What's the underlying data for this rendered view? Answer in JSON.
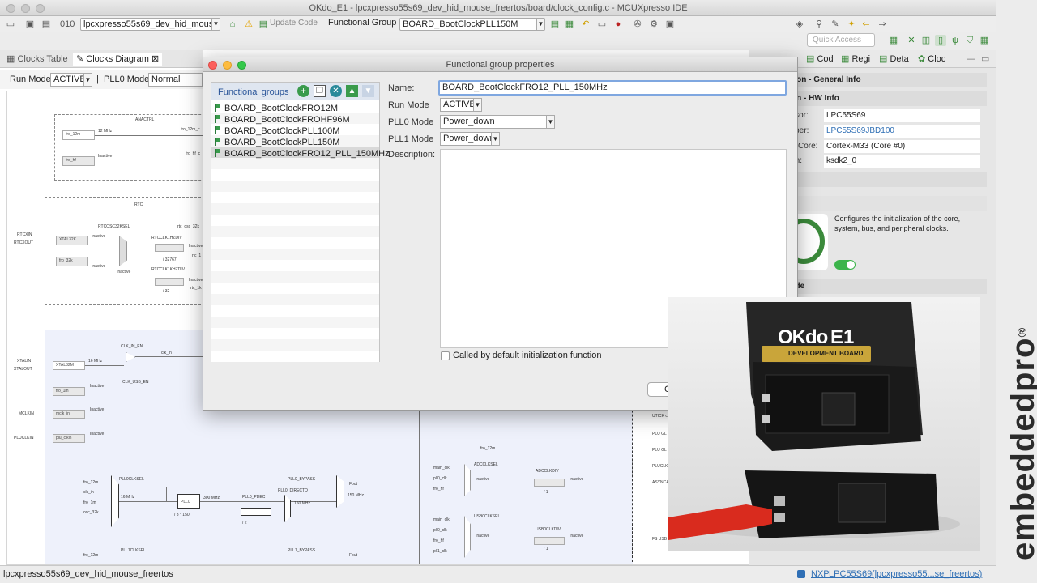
{
  "window": {
    "title": "OKdo_E1 - lpcxpresso55s69_dev_hid_mouse_freertos/board/clock_config.c - MCUXpresso IDE"
  },
  "toolbar": {
    "project_combo": "lpcxpresso55s69_dev_hid_mouse_f",
    "update_code": "Update Code",
    "functional_group_label": "Functional Group",
    "functional_group_value": "BOARD_BootClockPLL150M",
    "quick_access_placeholder": "Quick Access"
  },
  "left_tabs": {
    "clocks_table": "Clocks Table",
    "clocks_diagram": "Clocks Diagram"
  },
  "run_row": {
    "run_mode_label": "Run Mode",
    "run_mode_value": "ACTIVE",
    "pll0_mode_label": "PLL0 Mode",
    "pll0_mode_value": "Normal"
  },
  "diagram": {
    "anactrl": "ANACTRL",
    "fro_12m": "fro_12m",
    "mhz12": "12 MHz",
    "fro_12m_clk": "fro_12m_c",
    "inactive": "Inactive",
    "fro_hf": "fro_hf",
    "fro_hf_clk": "fro_hf_c",
    "rtc": "RTC",
    "rtcxin": "RTCXIN",
    "rtcxout": "RTCXOUT",
    "xtal32k": "XTAL32K",
    "fro_32k": "fro_32k",
    "rtcosc32ksel": "RTCOSC32KSEL",
    "rtc_osc_32k": "rtc_osc_32k",
    "rtcclk1hzdiv": "RTCCLK1HZDIV",
    "rtc_1": "rtc_1",
    "div32767": "/ 32767",
    "rtcclk1khzdiv": "RTCCLK1KHZDIV",
    "div32": "/ 32",
    "rtc_1k": "rtc_1k",
    "xtalin": "XTALIN",
    "xtalout": "XTALOUT",
    "xtal32m": "XTAL32M",
    "mhz16": "16 MHz",
    "clk_in_en": "CLK_IN_EN",
    "clk_in": "clk_in",
    "clk_usb_en": "CLK_USB_EN",
    "fro_1m": "fro_1m",
    "mclkin": "MCLKIN",
    "mclk_in": "mclk_in",
    "plu_clkin_pin": "PLUCLKIN",
    "plu_clkin": "plu_clkin",
    "pll0clksel": "PLL0CLKSEL",
    "pll0": "PLL0",
    "mhz300": "300 MHz",
    "pll0_pdec": "PLL0_PDEC",
    "pll0_bypass": "PLL0_BYPASS",
    "pll0_directo": "PLL0_DIRECTO",
    "mhz150": "150 MHz",
    "fout": "Fout",
    "mul150": "/ 8 * 150",
    "div2": "/ 2",
    "osc_32k": "osc_32k",
    "pll1clksel": "PLL1CLKSEL",
    "pll1_bypass": "PLL1_BYPASS",
    "fro_12m_b": "fro_12m",
    "main_clk": "main_clk",
    "pll0_clk": "pll0_clk",
    "fro_hf_b": "fro_hf",
    "adcclksel": "ADCCLKSEL",
    "adcclkdiv": "ADCCLKDIV",
    "div1": "/ 1",
    "usb0clksel": "USB0CLKSEL",
    "usb0clkdiv": "USB0CLKDIV",
    "fro_hf_c2": "fro_hf",
    "pll1_clk": "pll1_clk",
    "utick": "UTICK c",
    "plu_gl": "PLU GL",
    "plu_glb": "PLU GL",
    "pluclk": "PLUCLK",
    "async": "ASYNCA",
    "fs_usb": "FS USB"
  },
  "dialog": {
    "title": "Functional group properties",
    "groups_header": "Functional groups",
    "groups": [
      "BOARD_BootClockFRO12M",
      "BOARD_BootClockFROHF96M",
      "BOARD_BootClockPLL100M",
      "BOARD_BootClockPLL150M",
      "BOARD_BootClockFRO12_PLL_150MHz"
    ],
    "name_label": "Name:",
    "name_value": "BOARD_BootClockFRO12_PLL_150MHz",
    "run_mode_label": "Run Mode",
    "run_mode_value": "ACTIVE",
    "pll0_mode_label": "PLL0 Mode",
    "pll0_mode_value": "Power_down",
    "pll1_mode_label": "PLL1 Mode",
    "pll1_mode_value": "Power_down",
    "description_label": "Description:",
    "checkbox_label": "Called by default initialization function",
    "cancel_button": "C"
  },
  "right_panel": {
    "tabs": [
      "Cod",
      "Regi",
      "Deta",
      "Cloc"
    ],
    "general_info": "onfiguration - General Info",
    "hw_info": "nfiguration - HW Info",
    "processor_label": "ocessor:",
    "processor_value": "LPC55S69",
    "part_label": "Number:",
    "part_value": "LPC55S69JBD100",
    "core_label": "Core:",
    "core_value": "Cortex-M33 (Core #0)",
    "version_label": "ersion:",
    "version_value": "ksdk2_0",
    "project": "ject",
    "clocks": "cks",
    "clocks_desc": "Configures the initialization of the core, system, bus, and peripheral clocks.",
    "generated_code": "erated code"
  },
  "video": {
    "okdo_logo": "OKdo",
    "e1": "E1",
    "dev_board": "DEVELOPMENT BOARD"
  },
  "brand": {
    "text": "embeddedpro",
    "mark": "®"
  },
  "status": {
    "project": "lpcxpresso55s69_dev_hid_mouse_freertos",
    "nxp": "NXP",
    "chip": "LPC55S69",
    "proj_short": "(lpcxpresso55...se_freertos)"
  }
}
